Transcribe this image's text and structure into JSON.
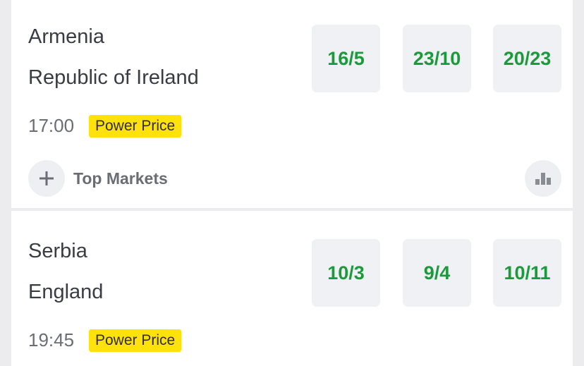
{
  "events": [
    {
      "home": "Armenia",
      "away": "Republic of Ireland",
      "time": "17:00",
      "badge": "Power Price",
      "odds": [
        "16/5",
        "23/10",
        "20/23"
      ],
      "markets_label": "Top Markets"
    },
    {
      "home": "Serbia",
      "away": "England",
      "time": "19:45",
      "badge": "Power Price",
      "odds": [
        "10/3",
        "9/4",
        "10/11"
      ]
    }
  ],
  "colors": {
    "odds_text": "#1b9a3c",
    "badge_bg": "#ffe20c",
    "odds_bg": "#f0f1f4"
  },
  "icons": {
    "expand": "plus-icon",
    "stats": "bar-chart-icon"
  }
}
